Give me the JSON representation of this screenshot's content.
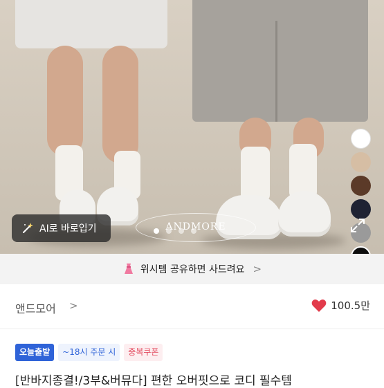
{
  "hero": {
    "watermark": "ANDMORE",
    "ai_button_label": "AI로 바로입기",
    "carousel_dots": 4,
    "carousel_active_index": 0,
    "color_swatches": [
      "#ffffff",
      "#d6bea4",
      "#5b3a28",
      "#1e2233",
      "#9a9a9a",
      "#0d0d0d"
    ],
    "selected_swatch_index": 5
  },
  "wish_banner": {
    "text": "위시템 공유하면 사드려요",
    "chevron": ">"
  },
  "brand": {
    "name": "앤드모어",
    "chevron": ">",
    "likes": "100.5만",
    "like_color": "#e23b4b"
  },
  "badges": {
    "today_ship": "오늘출발",
    "order_cutoff": "~18시 주문 시",
    "coupon": "중복쿠폰"
  },
  "product": {
    "title": "[반바지종결!/3부&버뮤다] 편한 오버핏으로 코디 필수템"
  }
}
